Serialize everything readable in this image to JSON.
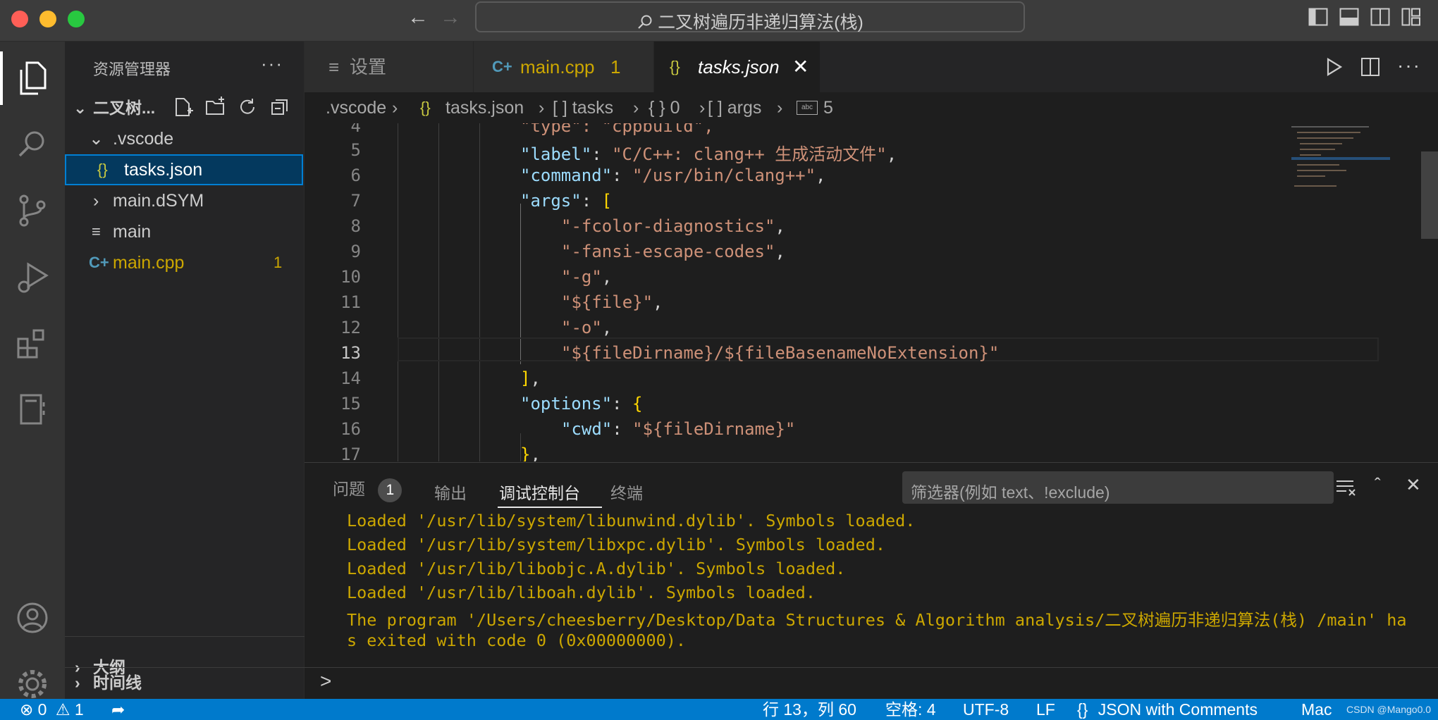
{
  "window": {
    "title": "二叉树遍历非递归算法(栈)"
  },
  "sidebar": {
    "title": "资源管理器",
    "more": "···",
    "folder": "二叉树...",
    "tree": [
      {
        "label": ".vscode",
        "type": "folder-open"
      },
      {
        "label": "tasks.json",
        "type": "json",
        "selected": true
      },
      {
        "label": "main.dSYM",
        "type": "folder-closed"
      },
      {
        "label": "main",
        "type": "file"
      },
      {
        "label": "main.cpp",
        "type": "cpp",
        "badge": "1"
      }
    ],
    "outline": "大纲",
    "timeline": "时间线"
  },
  "tabs": [
    {
      "label": "设置",
      "icon": "settings-lines-icon"
    },
    {
      "label": "main.cpp",
      "badge": "1",
      "icon": "cpp-icon"
    },
    {
      "label": "tasks.json",
      "icon": "json-braces-icon",
      "active": true
    }
  ],
  "breadcrumb": {
    "items": [
      ".vscode",
      "tasks.json",
      "[ ] tasks",
      "{ } 0",
      "[ ] args",
      "5"
    ]
  },
  "editor": {
    "cursor_line": 13,
    "lines": [
      {
        "n": "4",
        "partial": "\"type\": \"cppbuild\","
      },
      {
        "n": "5",
        "key": "\"label\"",
        "val": "\"C/C++: clang++ 生成活动文件\"",
        "end": ","
      },
      {
        "n": "6",
        "key": "\"command\"",
        "val": "\"/usr/bin/clang++\"",
        "end": ","
      },
      {
        "n": "7",
        "key": "\"args\"",
        "val": "[",
        "end": ""
      },
      {
        "n": "8",
        "str": "\"-fcolor-diagnostics\"",
        "end": ","
      },
      {
        "n": "9",
        "str": "\"-fansi-escape-codes\"",
        "end": ","
      },
      {
        "n": "10",
        "str": "\"-g\"",
        "end": ","
      },
      {
        "n": "11",
        "str": "\"${file}\"",
        "end": ","
      },
      {
        "n": "12",
        "str": "\"-o\"",
        "end": ","
      },
      {
        "n": "13",
        "str": "\"${fileDirname}/${fileBasenameNoExtension}\"",
        "end": ""
      },
      {
        "n": "14",
        "close": "]",
        "end": ","
      },
      {
        "n": "15",
        "key": "\"options\"",
        "val": "{",
        "end": ""
      },
      {
        "n": "16",
        "key": "\"cwd\"",
        "val": "\"${fileDirname}\"",
        "end": ""
      },
      {
        "n": "17",
        "close": "}",
        "end": ","
      }
    ]
  },
  "panel": {
    "tabs": [
      {
        "label": "问题",
        "badge": "1"
      },
      {
        "label": "输出"
      },
      {
        "label": "调试控制台",
        "active": true
      },
      {
        "label": "终端"
      }
    ],
    "filter_placeholder": "筛选器(例如 text、!exclude)",
    "console": [
      "Loaded '/usr/lib/system/libunwind.dylib'. Symbols loaded.",
      "Loaded '/usr/lib/system/libxpc.dylib'. Symbols loaded.",
      "Loaded '/usr/lib/libobjc.A.dylib'. Symbols loaded.",
      "Loaded '/usr/lib/liboah.dylib'. Symbols loaded.",
      "The program '/Users/cheesberry/Desktop/Data Structures & Algorithm analysis/二叉树遍历非递归算法(栈) /main' ha",
      "s exited with code 0 (0x00000000)."
    ],
    "prompt": ">"
  },
  "status": {
    "errors": "0",
    "warnings": "1",
    "position": "行 13，列 60",
    "spaces": "空格: 4",
    "encoding": "UTF-8",
    "eol": "LF",
    "language": "JSON with Comments",
    "platform": "Mac",
    "watermark": "CSDN @Mango0.0"
  },
  "colors": {
    "accent": "#007acc",
    "warning": "#cca700",
    "key": "#9cdcfe",
    "string": "#ce9178"
  }
}
